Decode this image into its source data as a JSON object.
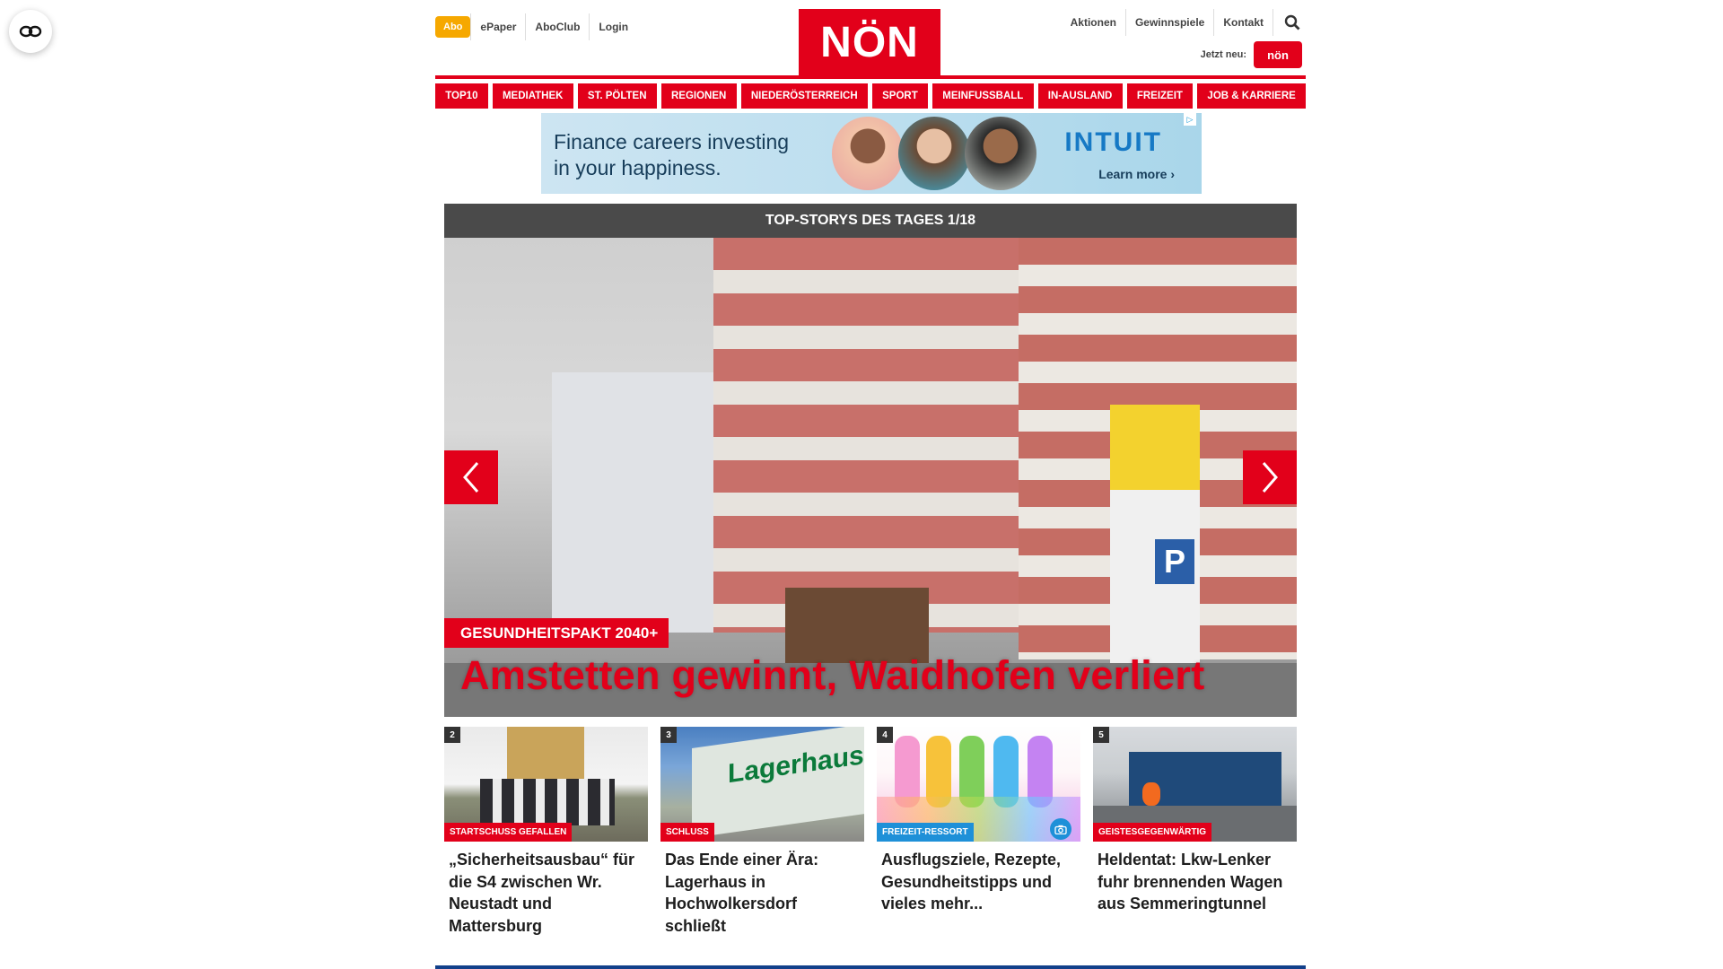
{
  "header": {
    "abo_label": "Abo",
    "left_links": [
      "ePaper",
      "AboClub",
      "Login"
    ],
    "logo_text": "NÖN",
    "right_links": [
      "Aktionen",
      "Gewinnspiele",
      "Kontakt"
    ],
    "jetzt_neu_label": "Jetzt neu:",
    "mini_logo_text": "nön",
    "brand_color": "#e2001a"
  },
  "nav": {
    "items": [
      "TOP10",
      "MEDIATHEK",
      "ST. PÖLTEN",
      "REGIONEN",
      "NIEDERÖSTERREICH",
      "SPORT",
      "MEINFUSSBALL",
      "IN-AUSLAND",
      "FREIZEIT",
      "JOB & KARRIERE"
    ]
  },
  "ad": {
    "text_line1": "Finance careers investing",
    "text_line2": "in your happiness.",
    "brand": "INTUIT",
    "cta": "Learn more ›"
  },
  "hero": {
    "section_title": "TOP-STORYS DES TAGES 1/18",
    "kicker": "GESUNDHEITSPAKT 2040+",
    "title": "Amstetten gewinnt, Waidhofen verliert",
    "image_sign_text": "P"
  },
  "teasers": [
    {
      "number": "2",
      "kicker": "STARTSCHUSS GEFALLEN",
      "title": "„Sicherheitsausbau“ für die S4 zwischen Wr. Neustadt und Mattersburg"
    },
    {
      "number": "3",
      "kicker": "SCHLUSS",
      "title": "Das Ende einer Ära: Lagerhaus in Hochwolkersdorf schließt",
      "image_text": "Lagerhaus"
    },
    {
      "number": "4",
      "kicker": "FREIZEIT-RESSORT",
      "title": "Ausflugsziele, Rezepte, Gesundheitstipps und vieles mehr..."
    },
    {
      "number": "5",
      "kicker": "GEISTESGEGENWÄRTIG",
      "title": "Heldentat: Lkw-Lenker fuhr brennenden Wagen aus Semmeringtunnel"
    }
  ]
}
